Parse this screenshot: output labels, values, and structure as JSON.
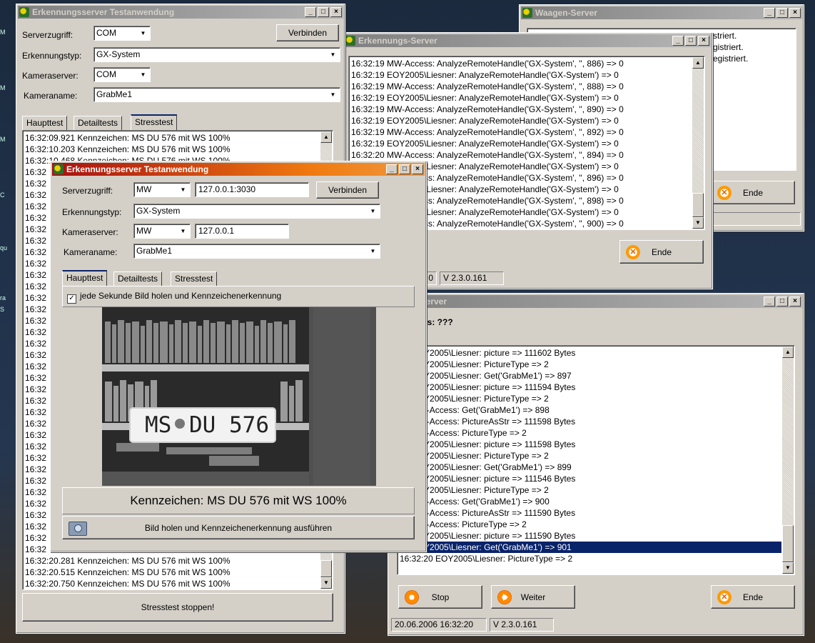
{
  "win_waagen": {
    "title": "Waagen-Server",
    "lines": [
      "striert.",
      "gistriert.",
      "egistriert."
    ],
    "end_label": "Ende"
  },
  "win_erk_server": {
    "title": "Erkennungs-Server",
    "log": [
      "16:32:19 MW-Access: AnalyzeRemoteHandle('GX-System', '', 886) => 0",
      "16:32:19 EOY2005\\Liesner: AnalyzeRemoteHandle('GX-System') => 0",
      "16:32:19 MW-Access: AnalyzeRemoteHandle('GX-System', '', 888) => 0",
      "16:32:19 EOY2005\\Liesner: AnalyzeRemoteHandle('GX-System') => 0",
      "16:32:19 MW-Access: AnalyzeRemoteHandle('GX-System', '', 890) => 0",
      "16:32:19 EOY2005\\Liesner: AnalyzeRemoteHandle('GX-System') => 0",
      "16:32:19 MW-Access: AnalyzeRemoteHandle('GX-System', '', 892) => 0",
      "16:32:19 EOY2005\\Liesner: AnalyzeRemoteHandle('GX-System') => 0",
      "16:32:20 MW-Access: AnalyzeRemoteHandle('GX-System', '', 894) => 0",
      "16:32:20 EOY2005\\Liesner: AnalyzeRemoteHandle('GX-System') => 0",
      "16:32:20 MW-Access: AnalyzeRemoteHandle('GX-System', '', 896) => 0",
      "16:32:20 EOY2005\\Liesner: AnalyzeRemoteHandle('GX-System') => 0",
      "16:32:20 MW-Access: AnalyzeRemoteHandle('GX-System', '', 898) => 0",
      "16:32:20 EOY2005\\Liesner: AnalyzeRemoteHandle('GX-System') => 0",
      "16:32:20 MW-Access: AnalyzeRemoteHandle('GX-System', '', 900) => 0"
    ],
    "end_label": "Ende",
    "status_left": "0",
    "status_version": "V  2.3.0.161"
  },
  "win_snapshot": {
    "title": "hot-Server",
    "status_label": "r-Status:  ???",
    "log": [
      "20 EOY2005\\Liesner: picture => 111602 Bytes",
      "20 EOY2005\\Liesner: PictureType => 2",
      "20 EOY2005\\Liesner: Get('GrabMe1') => 897",
      "20 EOY2005\\Liesner: picture => 111594 Bytes",
      "20 EOY2005\\Liesner: PictureType => 2",
      "20 MW-Access: Get('GrabMe1') => 898",
      "20 MW-Access: PictureAsStr => 111598 Bytes",
      "20 MW-Access: PictureType => 2",
      "20 EOY2005\\Liesner: picture => 111598 Bytes",
      "20 EOY2005\\Liesner: PictureType => 2",
      "20 EOY2005\\Liesner: Get('GrabMe1') => 899",
      "20 EOY2005\\Liesner: picture => 111546 Bytes",
      "20 EOY2005\\Liesner: PictureType => 2",
      "20 MW-Access: Get('GrabMe1') => 900",
      "20 MW-Access: PictureAsStr => 111590 Bytes",
      "20 MW-Access: PictureType => 2",
      "20 EOY2005\\Liesner: picture => 111590 Bytes",
      "20 EOY2005\\Liesner: Get('GrabMe1') => 901",
      "16:32:20 EOY2005\\Liesner: PictureType => 2"
    ],
    "stop_label": "Stop",
    "weiter_label": "Weiter",
    "end_label": "Ende",
    "status_time": "20.06.2006 16:32:20",
    "status_version": "V  2.3.0.161"
  },
  "win_back": {
    "title": "Erkennungsserver Testanwendung",
    "serverzugriff_label": "Serverzugriff:",
    "serverzugriff_value": "COM",
    "verbinden_label": "Verbinden",
    "erkennungstyp_label": "Erkennungstyp:",
    "erkennungstyp_value": "GX-System",
    "kameraserver_label": "Kameraserver:",
    "kameraserver_value": "COM",
    "kameraname_label": "Kameraname:",
    "kameraname_value": "GrabMe1",
    "tabs": [
      "Haupttest",
      "Detailtests",
      "Stresstest"
    ],
    "log_top": [
      "16:32:09.921 Kennzeichen: MS DU 576 mit WS 100%",
      "16:32:10.203 Kennzeichen: MS DU 576 mit WS 100%",
      "16:32:10.468 Kennzeichen: MS DU 576 mit WS 100%"
    ],
    "log_stub": "16:32",
    "log_bottom": [
      "16:32",
      "16:32:20.281 Kennzeichen: MS DU 576 mit WS 100%",
      "16:32:20.515 Kennzeichen: MS DU 576 mit WS 100%",
      "16:32:20.750 Kennzeichen: MS DU 576 mit WS 100%"
    ],
    "stop_button": "Stresstest stoppen!"
  },
  "win_front": {
    "title": "Erkennungsserver Testanwendung",
    "serverzugriff_label": "Serverzugriff:",
    "serverzugriff_value": "MW",
    "ip_value": "127.0.0.1:3030",
    "verbinden_label": "Verbinden",
    "erkennungstyp_label": "Erkennungstyp:",
    "erkennungstyp_value": "GX-System",
    "kameraserver_label": "Kameraserver:",
    "kameraserver_value": "MW",
    "kamera_ip_value": "127.0.0.1",
    "kameraname_label": "Kameraname:",
    "kameraname_value": "GrabMe1",
    "tabs": [
      "Haupttest",
      "Detailtests",
      "Stresstest"
    ],
    "checkbox_label": "jede Sekunde Bild holen und Kennzeichenerkennung",
    "plate_text": "MS",
    "plate_text2": "DU 576",
    "result_text": "Kennzeichen: MS DU 576 mit WS 100%",
    "action_button": "Bild holen und Kennzeichenerkennung ausführen"
  },
  "desktop": {
    "fragments": [
      "M",
      "M",
      "M",
      "C",
      "qu",
      "ra",
      "S"
    ]
  }
}
